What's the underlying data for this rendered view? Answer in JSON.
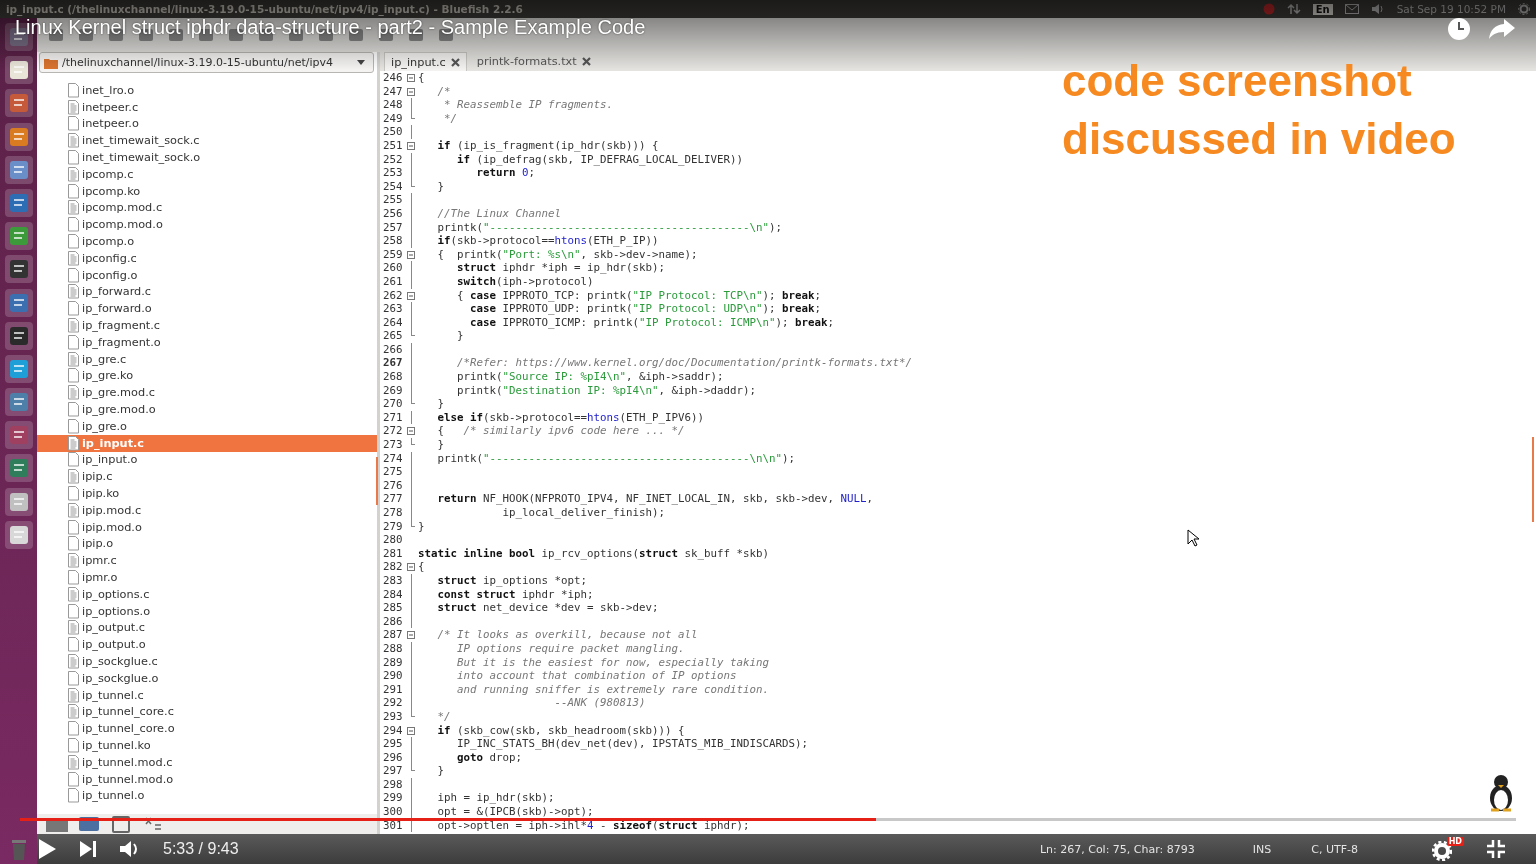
{
  "top_panel": {
    "window_title": "ip_input.c (/thelinuxchannel/linux-3.19.0-15-ubuntu/net/ipv4/ip_input.c) - Bluefish 2.2.6",
    "keyboard": "En",
    "clock": "Sat Sep 19 10:52 PM"
  },
  "video": {
    "title": "Linux Kernel struct iphdr data-structure - part2 - Sample Example Code",
    "overlay_text": [
      "code screenshot",
      "discussed in video"
    ],
    "time": "5:33 / 9:43",
    "progress": {
      "level": 0.572
    },
    "quality_badge": "HD"
  },
  "file_browser": {
    "path": "/thelinuxchannel/linux-3.19.0-15-ubuntu/net/ipv4",
    "files": [
      {
        "name": "inet_lro.o",
        "kind": "binary",
        "selected": false
      },
      {
        "name": "inetpeer.c",
        "kind": "source",
        "selected": false
      },
      {
        "name": "inetpeer.o",
        "kind": "binary",
        "selected": false
      },
      {
        "name": "inet_timewait_sock.c",
        "kind": "source",
        "selected": false
      },
      {
        "name": "inet_timewait_sock.o",
        "kind": "binary",
        "selected": false
      },
      {
        "name": "ipcomp.c",
        "kind": "source",
        "selected": false
      },
      {
        "name": "ipcomp.ko",
        "kind": "binary",
        "selected": false
      },
      {
        "name": "ipcomp.mod.c",
        "kind": "source",
        "selected": false
      },
      {
        "name": "ipcomp.mod.o",
        "kind": "binary",
        "selected": false
      },
      {
        "name": "ipcomp.o",
        "kind": "binary",
        "selected": false
      },
      {
        "name": "ipconfig.c",
        "kind": "source",
        "selected": false
      },
      {
        "name": "ipconfig.o",
        "kind": "binary",
        "selected": false
      },
      {
        "name": "ip_forward.c",
        "kind": "source",
        "selected": false
      },
      {
        "name": "ip_forward.o",
        "kind": "binary",
        "selected": false
      },
      {
        "name": "ip_fragment.c",
        "kind": "source",
        "selected": false
      },
      {
        "name": "ip_fragment.o",
        "kind": "binary",
        "selected": false
      },
      {
        "name": "ip_gre.c",
        "kind": "source",
        "selected": false
      },
      {
        "name": "ip_gre.ko",
        "kind": "binary",
        "selected": false
      },
      {
        "name": "ip_gre.mod.c",
        "kind": "source",
        "selected": false
      },
      {
        "name": "ip_gre.mod.o",
        "kind": "binary",
        "selected": false
      },
      {
        "name": "ip_gre.o",
        "kind": "binary",
        "selected": false
      },
      {
        "name": "ip_input.c",
        "kind": "source",
        "selected": true
      },
      {
        "name": "ip_input.o",
        "kind": "binary",
        "selected": false
      },
      {
        "name": "ipip.c",
        "kind": "source",
        "selected": false
      },
      {
        "name": "ipip.ko",
        "kind": "binary",
        "selected": false
      },
      {
        "name": "ipip.mod.c",
        "kind": "source",
        "selected": false
      },
      {
        "name": "ipip.mod.o",
        "kind": "binary",
        "selected": false
      },
      {
        "name": "ipip.o",
        "kind": "binary",
        "selected": false
      },
      {
        "name": "ipmr.c",
        "kind": "source",
        "selected": false
      },
      {
        "name": "ipmr.o",
        "kind": "binary",
        "selected": false
      },
      {
        "name": "ip_options.c",
        "kind": "source",
        "selected": false
      },
      {
        "name": "ip_options.o",
        "kind": "binary",
        "selected": false
      },
      {
        "name": "ip_output.c",
        "kind": "source",
        "selected": false
      },
      {
        "name": "ip_output.o",
        "kind": "binary",
        "selected": false
      },
      {
        "name": "ip_sockglue.c",
        "kind": "source",
        "selected": false
      },
      {
        "name": "ip_sockglue.o",
        "kind": "binary",
        "selected": false
      },
      {
        "name": "ip_tunnel.c",
        "kind": "source",
        "selected": false
      },
      {
        "name": "ip_tunnel_core.c",
        "kind": "source",
        "selected": false
      },
      {
        "name": "ip_tunnel_core.o",
        "kind": "binary",
        "selected": false
      },
      {
        "name": "ip_tunnel.ko",
        "kind": "binary",
        "selected": false
      },
      {
        "name": "ip_tunnel.mod.c",
        "kind": "source",
        "selected": false
      },
      {
        "name": "ip_tunnel.mod.o",
        "kind": "binary",
        "selected": false
      },
      {
        "name": "ip_tunnel.o",
        "kind": "binary",
        "selected": false
      }
    ]
  },
  "editor": {
    "tabs": [
      {
        "label": "ip_input.c",
        "selected": true
      },
      {
        "label": "printk-formats.txt",
        "selected": false
      }
    ],
    "lines": [
      {
        "num": "246",
        "kind": "start",
        "current": false,
        "parts": [
          {
            "kind": "plain",
            "text": "{"
          }
        ]
      },
      {
        "num": "247",
        "kind": "start",
        "current": false,
        "parts": [
          {
            "kind": "cmt",
            "text": "   /*"
          }
        ]
      },
      {
        "num": "248",
        "kind": "body",
        "current": false,
        "parts": [
          {
            "kind": "cmt",
            "text": "    * Reassemble IP fragments."
          }
        ]
      },
      {
        "num": "249",
        "kind": "end",
        "current": false,
        "parts": [
          {
            "kind": "cmt",
            "text": "    */"
          }
        ]
      },
      {
        "num": "250",
        "kind": "body",
        "current": false
      },
      {
        "num": "251",
        "kind": "start",
        "current": false,
        "parts": [
          {
            "kind": "kw",
            "text": "   if"
          },
          {
            "kind": "plain",
            "text": " (ip_is_fragment(ip_hdr(skb))) {"
          }
        ]
      },
      {
        "num": "252",
        "kind": "body",
        "current": false,
        "parts": [
          {
            "kind": "kw",
            "text": "      if"
          },
          {
            "kind": "plain",
            "text": " (ip_defrag(skb, IP_DEFRAG_LOCAL_DELIVER))"
          }
        ]
      },
      {
        "num": "253",
        "kind": "body",
        "current": false,
        "parts": [
          {
            "kind": "kw",
            "text": "         return "
          },
          {
            "kind": "num",
            "text": "0"
          },
          {
            "kind": "plain",
            "text": ";"
          }
        ]
      },
      {
        "num": "254",
        "kind": "end",
        "current": false,
        "parts": [
          {
            "kind": "plain",
            "text": "   }"
          }
        ]
      },
      {
        "num": "255",
        "kind": "body",
        "current": false
      },
      {
        "num": "256",
        "kind": "body",
        "current": false,
        "parts": [
          {
            "kind": "cmt",
            "text": "   //The Linux Channel"
          }
        ]
      },
      {
        "num": "257",
        "kind": "body",
        "current": false,
        "parts": [
          {
            "kind": "plain",
            "text": "   printk("
          },
          {
            "kind": "str",
            "text": "\"----------------------------------------\\n\""
          },
          {
            "kind": "plain",
            "text": ");"
          }
        ]
      },
      {
        "num": "258",
        "kind": "body",
        "current": false,
        "parts": [
          {
            "kind": "kw",
            "text": "   if"
          },
          {
            "kind": "plain",
            "text": "(skb->protocol=="
          },
          {
            "kind": "num",
            "text": "htons"
          },
          {
            "kind": "plain",
            "text": "(ETH_P_IP))"
          }
        ]
      },
      {
        "num": "259",
        "kind": "start",
        "current": false,
        "parts": [
          {
            "kind": "plain",
            "text": "   {  printk("
          },
          {
            "kind": "str",
            "text": "\"Port: %s\\n\""
          },
          {
            "kind": "plain",
            "text": ", skb->dev->name);"
          }
        ]
      },
      {
        "num": "260",
        "kind": "body",
        "current": false,
        "parts": [
          {
            "kind": "kw",
            "text": "      struct"
          },
          {
            "kind": "plain",
            "text": " iphdr *iph = ip_hdr(skb);"
          }
        ]
      },
      {
        "num": "261",
        "kind": "body",
        "current": false,
        "parts": [
          {
            "kind": "kw",
            "text": "      switch"
          },
          {
            "kind": "plain",
            "text": "(iph->protocol)"
          }
        ]
      },
      {
        "num": "262",
        "kind": "start",
        "current": false,
        "parts": [
          {
            "kind": "plain",
            "text": "      { "
          },
          {
            "kind": "kw",
            "text": "case"
          },
          {
            "kind": "plain",
            "text": " IPPROTO_TCP: printk("
          },
          {
            "kind": "str",
            "text": "\"IP Protocol: TCP\\n\""
          },
          {
            "kind": "plain",
            "text": "); "
          },
          {
            "kind": "kw",
            "text": "break"
          },
          {
            "kind": "plain",
            "text": ";"
          }
        ]
      },
      {
        "num": "263",
        "kind": "body",
        "current": false,
        "parts": [
          {
            "kind": "kw",
            "text": "        case"
          },
          {
            "kind": "plain",
            "text": " IPPROTO_UDP: printk("
          },
          {
            "kind": "str",
            "text": "\"IP Protocol: UDP\\n\""
          },
          {
            "kind": "plain",
            "text": "); "
          },
          {
            "kind": "kw",
            "text": "break"
          },
          {
            "kind": "plain",
            "text": ";"
          }
        ]
      },
      {
        "num": "264",
        "kind": "body",
        "current": false,
        "parts": [
          {
            "kind": "kw",
            "text": "        case"
          },
          {
            "kind": "plain",
            "text": " IPPROTO_ICMP: printk("
          },
          {
            "kind": "str",
            "text": "\"IP Protocol: ICMP\\n\""
          },
          {
            "kind": "plain",
            "text": "); "
          },
          {
            "kind": "kw",
            "text": "break"
          },
          {
            "kind": "plain",
            "text": ";"
          }
        ]
      },
      {
        "num": "265",
        "kind": "end",
        "current": false,
        "parts": [
          {
            "kind": "plain",
            "text": "      }"
          }
        ]
      },
      {
        "num": "266",
        "kind": "body",
        "current": false
      },
      {
        "num": "267",
        "kind": "body",
        "current": true,
        "parts": [
          {
            "kind": "cmt",
            "text": "      /*Refer: https://www.kernel.org/doc/Documentation/printk-formats.txt*/"
          }
        ]
      },
      {
        "num": "268",
        "kind": "body",
        "current": false,
        "parts": [
          {
            "kind": "plain",
            "text": "      printk("
          },
          {
            "kind": "str",
            "text": "\"Source IP: %pI4\\n\""
          },
          {
            "kind": "plain",
            "text": ", &iph->saddr);"
          }
        ]
      },
      {
        "num": "269",
        "kind": "body",
        "current": false,
        "parts": [
          {
            "kind": "plain",
            "text": "      printk("
          },
          {
            "kind": "str",
            "text": "\"Destination IP: %pI4\\n\""
          },
          {
            "kind": "plain",
            "text": ", &iph->daddr);"
          }
        ]
      },
      {
        "num": "270",
        "kind": "end",
        "current": false,
        "parts": [
          {
            "kind": "plain",
            "text": "   }"
          }
        ]
      },
      {
        "num": "271",
        "kind": "body",
        "current": false,
        "parts": [
          {
            "kind": "kw",
            "text": "   else if"
          },
          {
            "kind": "plain",
            "text": "(skb->protocol=="
          },
          {
            "kind": "num",
            "text": "htons"
          },
          {
            "kind": "plain",
            "text": "(ETH_P_IPV6))"
          }
        ]
      },
      {
        "num": "272",
        "kind": "start",
        "current": false,
        "parts": [
          {
            "kind": "plain",
            "text": "   {   "
          },
          {
            "kind": "cmt",
            "text": "/* similarly ipv6 code here ... */"
          }
        ]
      },
      {
        "num": "273",
        "kind": "end",
        "current": false,
        "parts": [
          {
            "kind": "plain",
            "text": "   }"
          }
        ]
      },
      {
        "num": "274",
        "kind": "body",
        "current": false,
        "parts": [
          {
            "kind": "plain",
            "text": "   printk("
          },
          {
            "kind": "str",
            "text": "\"----------------------------------------\\n\\n\""
          },
          {
            "kind": "plain",
            "text": ");"
          }
        ]
      },
      {
        "num": "275",
        "kind": "body",
        "current": false
      },
      {
        "num": "276",
        "kind": "body",
        "current": false
      },
      {
        "num": "277",
        "kind": "body",
        "current": false,
        "parts": [
          {
            "kind": "kw",
            "text": "   return"
          },
          {
            "kind": "plain",
            "text": " NF_HOOK(NFPROTO_IPV4, NF_INET_LOCAL_IN, skb, skb->dev, "
          },
          {
            "kind": "num",
            "text": "NULL"
          },
          {
            "kind": "plain",
            "text": ","
          }
        ]
      },
      {
        "num": "278",
        "kind": "body",
        "current": false,
        "parts": [
          {
            "kind": "plain",
            "text": "             ip_local_deliver_finish);"
          }
        ]
      },
      {
        "num": "279",
        "kind": "end",
        "current": false,
        "parts": [
          {
            "kind": "plain",
            "text": "}"
          }
        ]
      },
      {
        "num": "280",
        "current": false
      },
      {
        "num": "281",
        "current": false,
        "parts": [
          {
            "kind": "kw",
            "text": "static inline bool"
          },
          {
            "kind": "plain",
            "text": " ip_rcv_options("
          },
          {
            "kind": "kw",
            "text": "struct"
          },
          {
            "kind": "plain",
            "text": " sk_buff *skb)"
          }
        ]
      },
      {
        "num": "282",
        "kind": "start",
        "current": false,
        "parts": [
          {
            "kind": "plain",
            "text": "{"
          }
        ]
      },
      {
        "num": "283",
        "kind": "body",
        "current": false,
        "parts": [
          {
            "kind": "kw",
            "text": "   struct"
          },
          {
            "kind": "plain",
            "text": " ip_options *opt;"
          }
        ]
      },
      {
        "num": "284",
        "kind": "body",
        "current": false,
        "parts": [
          {
            "kind": "kw",
            "text": "   const struct"
          },
          {
            "kind": "plain",
            "text": " iphdr *iph;"
          }
        ]
      },
      {
        "num": "285",
        "kind": "body",
        "current": false,
        "parts": [
          {
            "kind": "kw",
            "text": "   struct"
          },
          {
            "kind": "plain",
            "text": " net_device *dev = skb->dev;"
          }
        ]
      },
      {
        "num": "286",
        "kind": "body",
        "current": false
      },
      {
        "num": "287",
        "kind": "start",
        "current": false,
        "parts": [
          {
            "kind": "cmt",
            "text": "   /* It looks as overkill, because not all"
          }
        ]
      },
      {
        "num": "288",
        "kind": "body",
        "current": false,
        "parts": [
          {
            "kind": "cmt",
            "text": "      IP options require packet mangling."
          }
        ]
      },
      {
        "num": "289",
        "kind": "body",
        "current": false,
        "parts": [
          {
            "kind": "cmt",
            "text": "      But it is the easiest for now, especially taking"
          }
        ]
      },
      {
        "num": "290",
        "kind": "body",
        "current": false,
        "parts": [
          {
            "kind": "cmt",
            "text": "      into account that combination of IP options"
          }
        ]
      },
      {
        "num": "291",
        "kind": "body",
        "current": false,
        "parts": [
          {
            "kind": "cmt",
            "text": "      and running sniffer is extremely rare condition."
          }
        ]
      },
      {
        "num": "292",
        "kind": "body",
        "current": false,
        "parts": [
          {
            "kind": "cmt",
            "text": "                     --ANK (980813)"
          }
        ]
      },
      {
        "num": "293",
        "kind": "end",
        "current": false,
        "parts": [
          {
            "kind": "cmt",
            "text": "   */"
          }
        ]
      },
      {
        "num": "294",
        "kind": "start",
        "current": false,
        "parts": [
          {
            "kind": "kw",
            "text": "   if"
          },
          {
            "kind": "plain",
            "text": " (skb_cow(skb, skb_headroom(skb))) {"
          }
        ]
      },
      {
        "num": "295",
        "kind": "body",
        "current": false,
        "parts": [
          {
            "kind": "plain",
            "text": "      IP_INC_STATS_BH(dev_net(dev), IPSTATS_MIB_INDISCARDS);"
          }
        ]
      },
      {
        "num": "296",
        "kind": "body",
        "current": false,
        "parts": [
          {
            "kind": "kw",
            "text": "      goto"
          },
          {
            "kind": "plain",
            "text": " drop;"
          }
        ]
      },
      {
        "num": "297",
        "kind": "end",
        "current": false,
        "parts": [
          {
            "kind": "plain",
            "text": "   }"
          }
        ]
      },
      {
        "num": "298",
        "kind": "body",
        "current": false
      },
      {
        "num": "299",
        "kind": "body",
        "current": false,
        "parts": [
          {
            "kind": "plain",
            "text": "   iph = ip_hdr(skb);"
          }
        ]
      },
      {
        "num": "300",
        "kind": "body",
        "current": false,
        "parts": [
          {
            "kind": "plain",
            "text": "   opt = &(IPCB(skb)->opt);"
          }
        ]
      },
      {
        "num": "301",
        "kind": "body",
        "current": false,
        "parts": [
          {
            "kind": "plain",
            "text": "   opt->optlen = iph->ihl*"
          },
          {
            "kind": "num",
            "text": "4"
          },
          {
            "kind": "plain",
            "text": " - "
          },
          {
            "kind": "kw",
            "text": "sizeof"
          },
          {
            "kind": "plain",
            "text": "("
          },
          {
            "kind": "kw",
            "text": "struct"
          },
          {
            "kind": "plain",
            "text": " iphdr);"
          }
        ]
      }
    ]
  },
  "status_bar": {
    "position": "Ln: 267, Col: 75, Char: 8793",
    "mode": "INS",
    "language": "C, UTF-8"
  }
}
